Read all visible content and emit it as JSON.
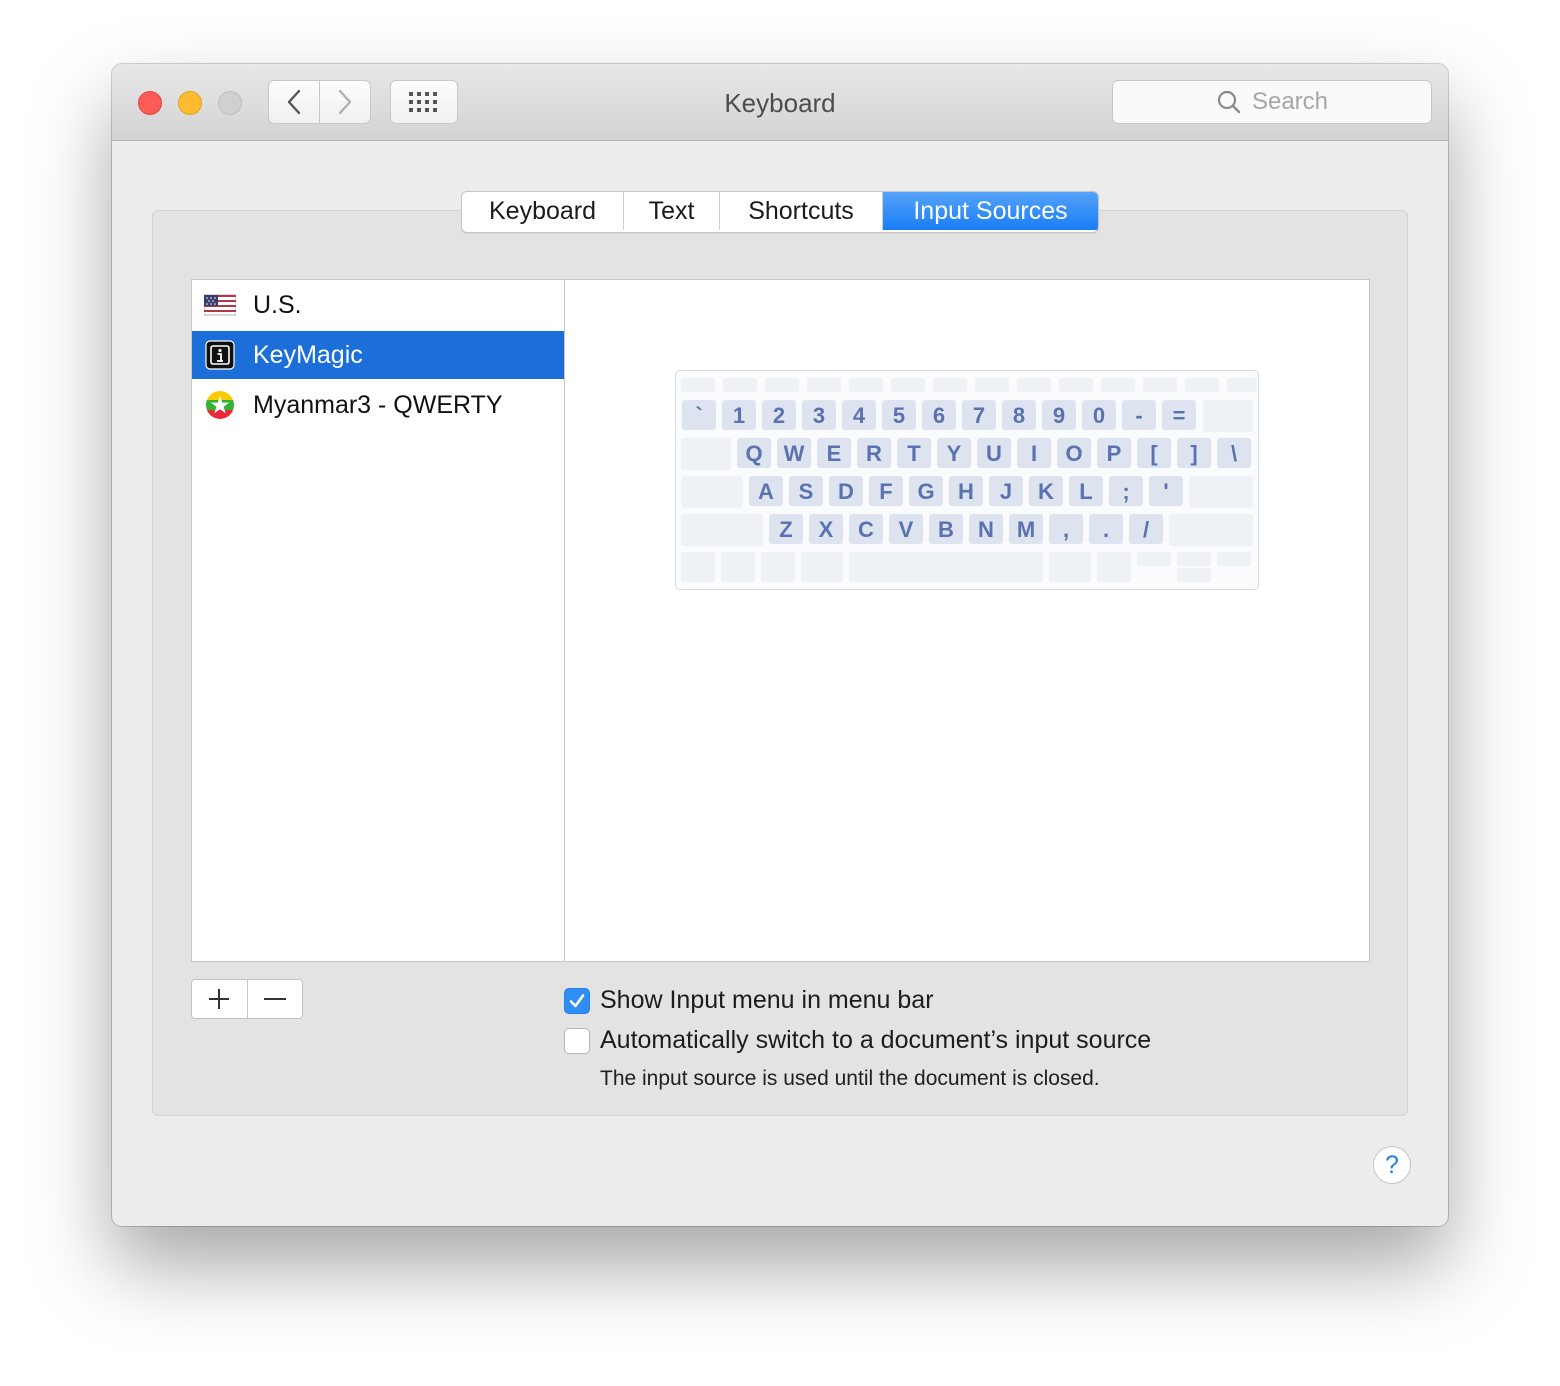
{
  "window": {
    "title": "Keyboard"
  },
  "search": {
    "placeholder": "Search"
  },
  "tabs": [
    {
      "label": "Keyboard",
      "active": false
    },
    {
      "label": "Text",
      "active": false
    },
    {
      "label": "Shortcuts",
      "active": false
    },
    {
      "label": "Input Sources",
      "active": true
    }
  ],
  "input_sources": [
    {
      "label": "U.S.",
      "icon": "us-flag-icon",
      "selected": false
    },
    {
      "label": "KeyMagic",
      "icon": "keymagic-icon",
      "selected": true
    },
    {
      "label": "Myanmar3 - QWERTY",
      "icon": "myanmar-flag-icon",
      "selected": false
    }
  ],
  "keyboard_preview": {
    "rows": [
      [
        "`",
        "1",
        "2",
        "3",
        "4",
        "5",
        "6",
        "7",
        "8",
        "9",
        "0",
        "-",
        "="
      ],
      [
        "Q",
        "W",
        "E",
        "R",
        "T",
        "Y",
        "U",
        "I",
        "O",
        "P",
        "[",
        "]",
        "\\"
      ],
      [
        "A",
        "S",
        "D",
        "F",
        "G",
        "H",
        "J",
        "K",
        "L",
        ";",
        "'"
      ],
      [
        "Z",
        "X",
        "C",
        "V",
        "B",
        "N",
        "M",
        ",",
        ".",
        "/"
      ]
    ]
  },
  "options": {
    "show_input_menu": {
      "label": "Show Input menu in menu bar",
      "checked": true
    },
    "auto_switch": {
      "label": "Automatically switch to a document’s input source",
      "checked": false
    },
    "auto_switch_note": "The input source is used until the document is closed."
  },
  "help": {
    "label": "?"
  },
  "colors": {
    "accent": "#1c6fd8",
    "key_text": "#5a72b0",
    "key_bg": "#dde3ef"
  }
}
